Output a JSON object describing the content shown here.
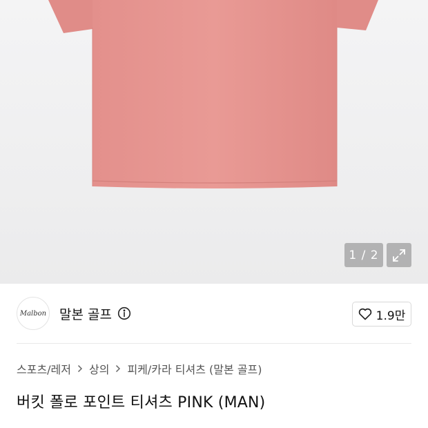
{
  "gallery": {
    "counter": "1 / 2",
    "shirt_color": "#e58f8b"
  },
  "brand": {
    "logo_text": "Malbon",
    "name": "말본 골프",
    "likes": "1.9만"
  },
  "breadcrumb": {
    "items": [
      "스포츠/레저",
      "상의",
      "피케/카라 티셔츠 (말본 골프)"
    ]
  },
  "product": {
    "title": "버킷 폴로 포인트 티셔츠 PINK (MAN)"
  }
}
